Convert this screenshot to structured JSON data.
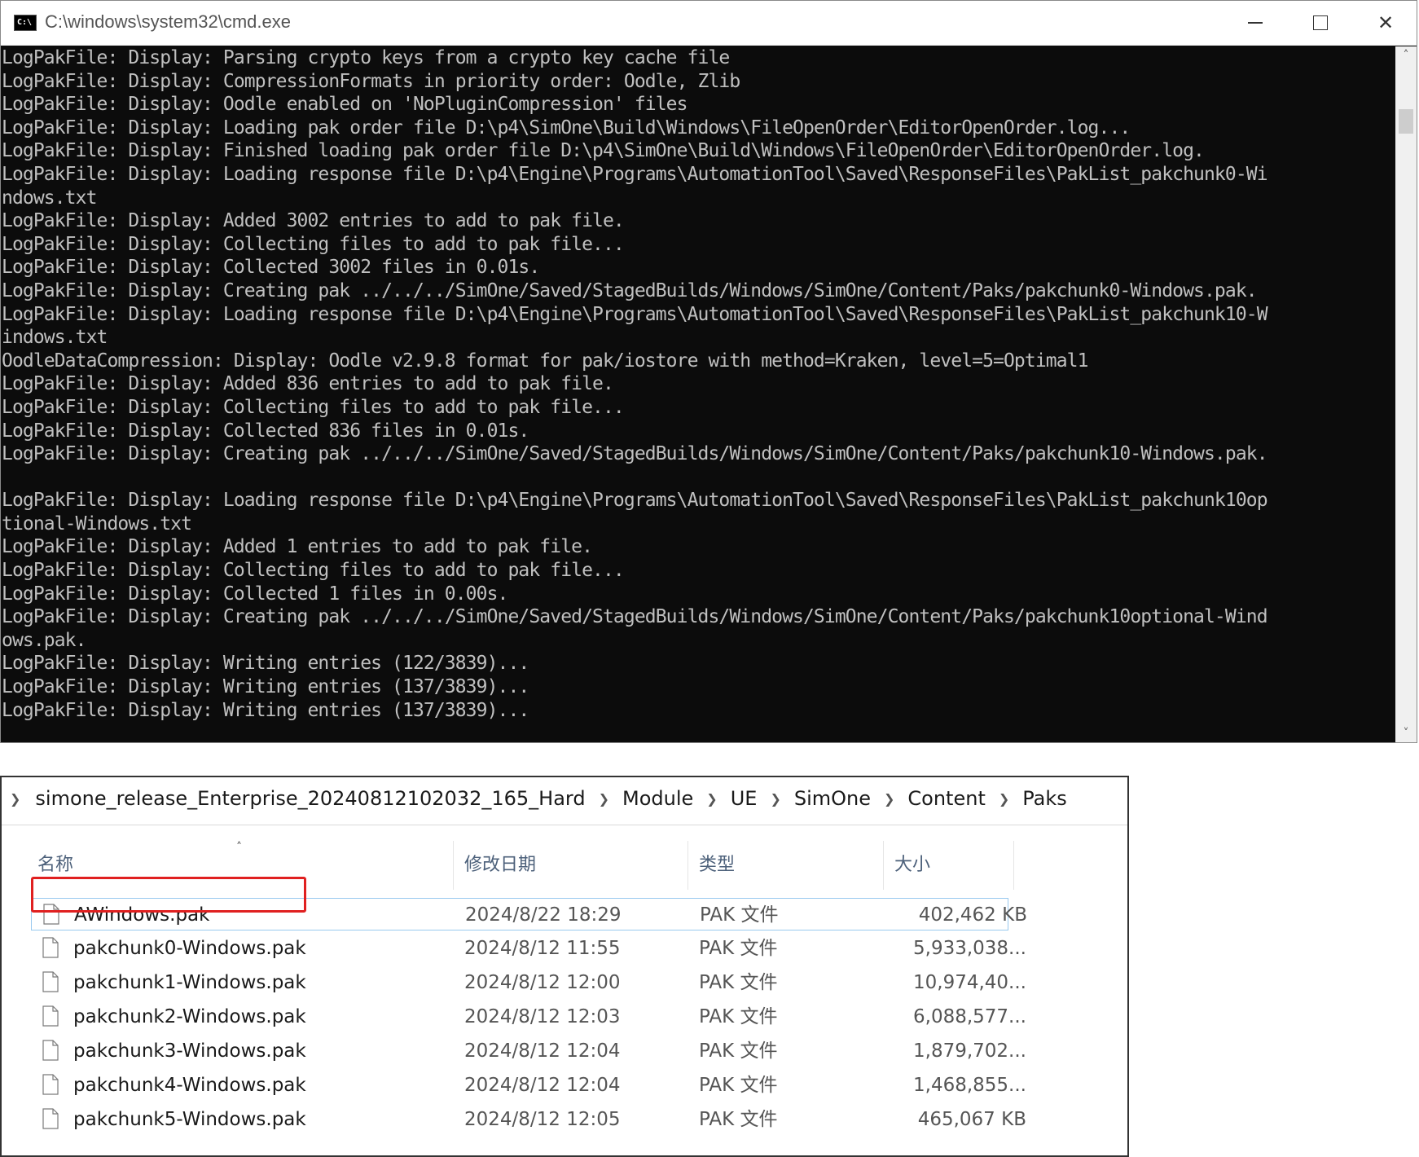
{
  "cmd": {
    "title": "C:\\windows\\system32\\cmd.exe",
    "icon_label": "C:\\",
    "controls": {
      "minimize": "minimize-icon",
      "maximize": "maximize-icon",
      "close": "✕"
    },
    "lines": [
      "LogPakFile: Display: Parsing crypto keys from a crypto key cache file",
      "LogPakFile: Display: CompressionFormats in priority order: Oodle, Zlib",
      "LogPakFile: Display: Oodle enabled on 'NoPluginCompression' files",
      "LogPakFile: Display: Loading pak order file D:\\p4\\SimOne\\Build\\Windows\\FileOpenOrder\\EditorOpenOrder.log...",
      "LogPakFile: Display: Finished loading pak order file D:\\p4\\SimOne\\Build\\Windows\\FileOpenOrder\\EditorOpenOrder.log.",
      "LogPakFile: Display: Loading response file D:\\p4\\Engine\\Programs\\AutomationTool\\Saved\\ResponseFiles\\PakList_pakchunk0-Wi",
      "ndows.txt",
      "LogPakFile: Display: Added 3002 entries to add to pak file.",
      "LogPakFile: Display: Collecting files to add to pak file...",
      "LogPakFile: Display: Collected 3002 files in 0.01s.",
      "LogPakFile: Display: Creating pak ../../../SimOne/Saved/StagedBuilds/Windows/SimOne/Content/Paks/pakchunk0-Windows.pak.",
      "LogPakFile: Display: Loading response file D:\\p4\\Engine\\Programs\\AutomationTool\\Saved\\ResponseFiles\\PakList_pakchunk10-W",
      "indows.txt",
      "OodleDataCompression: Display: Oodle v2.9.8 format for pak/iostore with method=Kraken, level=5=Optimal1",
      "LogPakFile: Display: Added 836 entries to add to pak file.",
      "LogPakFile: Display: Collecting files to add to pak file...",
      "LogPakFile: Display: Collected 836 files in 0.01s.",
      "LogPakFile: Display: Creating pak ../../../SimOne/Saved/StagedBuilds/Windows/SimOne/Content/Paks/pakchunk10-Windows.pak.",
      "",
      "LogPakFile: Display: Loading response file D:\\p4\\Engine\\Programs\\AutomationTool\\Saved\\ResponseFiles\\PakList_pakchunk10op",
      "tional-Windows.txt",
      "LogPakFile: Display: Added 1 entries to add to pak file.",
      "LogPakFile: Display: Collecting files to add to pak file...",
      "LogPakFile: Display: Collected 1 files in 0.00s.",
      "LogPakFile: Display: Creating pak ../../../SimOne/Saved/StagedBuilds/Windows/SimOne/Content/Paks/pakchunk10optional-Wind",
      "ows.pak.",
      "LogPakFile: Display: Writing entries (122/3839)...",
      "LogPakFile: Display: Writing entries (137/3839)...",
      "LogPakFile: Display: Writing entries (137/3839)..."
    ]
  },
  "explorer": {
    "breadcrumb": [
      "simone_release_Enterprise_20240812102032_165_Hard",
      "Module",
      "UE",
      "SimOne",
      "Content",
      "Paks"
    ],
    "columns": {
      "name": "名称",
      "date": "修改日期",
      "type": "类型",
      "size": "大小"
    },
    "files": [
      {
        "name": "AWindows.pak",
        "date": "2024/8/22 18:29",
        "type": "PAK 文件",
        "size": "402,462 KB",
        "selected": true
      },
      {
        "name": "pakchunk0-Windows.pak",
        "date": "2024/8/12 11:55",
        "type": "PAK 文件",
        "size": "5,933,038..."
      },
      {
        "name": "pakchunk1-Windows.pak",
        "date": "2024/8/12 12:00",
        "type": "PAK 文件",
        "size": "10,974,40..."
      },
      {
        "name": "pakchunk2-Windows.pak",
        "date": "2024/8/12 12:03",
        "type": "PAK 文件",
        "size": "6,088,577..."
      },
      {
        "name": "pakchunk3-Windows.pak",
        "date": "2024/8/12 12:04",
        "type": "PAK 文件",
        "size": "1,879,702..."
      },
      {
        "name": "pakchunk4-Windows.pak",
        "date": "2024/8/12 12:04",
        "type": "PAK 文件",
        "size": "1,468,855..."
      },
      {
        "name": "pakchunk5-Windows.pak",
        "date": "2024/8/12 12:05",
        "type": "PAK 文件",
        "size": "465,067 KB"
      }
    ],
    "colors": {
      "highlight_border": "#e02020",
      "selection_border": "#99c9ef"
    }
  }
}
